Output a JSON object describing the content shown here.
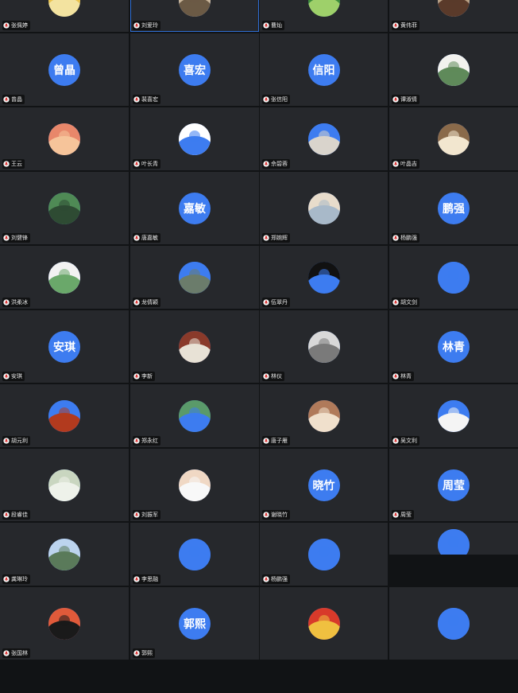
{
  "meeting": {
    "participants": [
      {
        "name": "张佩婷",
        "avatar_type": "photo",
        "avatar_colors": [
          "#e9c24d",
          "#f3e3a0"
        ],
        "speaking": false
      },
      {
        "name": "刘爱玲",
        "avatar_type": "photo",
        "avatar_colors": [
          "#c8b59a",
          "#6b5a45"
        ],
        "speaking": true
      },
      {
        "name": "曹灿",
        "avatar_type": "photo",
        "avatar_colors": [
          "#3c8a3a",
          "#9ed06a"
        ],
        "speaking": false
      },
      {
        "name": "黄伟菲",
        "avatar_type": "photo",
        "avatar_colors": [
          "#b8a084",
          "#5a3a2a"
        ],
        "speaking": false
      },
      {
        "name": "曾晶",
        "avatar_type": "text",
        "avatar_text": "曾晶"
      },
      {
        "name": "裴喜宏",
        "avatar_type": "text",
        "avatar_text": "喜宏"
      },
      {
        "name": "张信阳",
        "avatar_type": "text",
        "avatar_text": "信阳"
      },
      {
        "name": "谭淑倩",
        "avatar_type": "photo",
        "avatar_colors": [
          "#f2f2ee",
          "#5f8a5a"
        ]
      },
      {
        "name": "王云",
        "avatar_type": "photo",
        "avatar_colors": [
          "#e8876a",
          "#f6c49a"
        ]
      },
      {
        "name": "叶长青",
        "avatar_type": "photo",
        "avatar_colors": [
          "#ffffff",
          "#3d7cf0"
        ]
      },
      {
        "name": "佘碧蓉",
        "avatar_type": "photo",
        "avatar_colors": [
          "#3d7cf0",
          "#d9d4cc"
        ]
      },
      {
        "name": "叶晶吉",
        "avatar_type": "photo",
        "avatar_colors": [
          "#8a6a4a",
          "#f2e6cf"
        ]
      },
      {
        "name": "刘健锋",
        "avatar_type": "photo",
        "avatar_colors": [
          "#4f8a55",
          "#2e4b33"
        ]
      },
      {
        "name": "唐嘉敏",
        "avatar_type": "text",
        "avatar_text": "嘉敏"
      },
      {
        "name": "郑婉辉",
        "avatar_type": "photo",
        "avatar_colors": [
          "#e8dccb",
          "#a8b9c9"
        ]
      },
      {
        "name": "杨鹏强",
        "avatar_type": "text",
        "avatar_text": "鹏强"
      },
      {
        "name": "洪柔冰",
        "avatar_type": "photo",
        "avatar_colors": [
          "#f2f2f2",
          "#6aa86a"
        ]
      },
      {
        "name": "龙倩颖",
        "avatar_type": "photo",
        "avatar_colors": [
          "#3d7cf0",
          "#6b7c6b"
        ]
      },
      {
        "name": "伍翠丹",
        "avatar_type": "photo",
        "avatar_colors": [
          "#111111",
          "#3d7cf0"
        ]
      },
      {
        "name": "胡文剑",
        "avatar_type": "photo",
        "avatar_colors": [
          "#3d7cf0",
          "#3d7cf0"
        ]
      },
      {
        "name": "安琪",
        "avatar_type": "text",
        "avatar_text": "安琪"
      },
      {
        "name": "李新",
        "avatar_type": "photo",
        "avatar_colors": [
          "#8a3a2a",
          "#e8e2d6"
        ]
      },
      {
        "name": "林仪",
        "avatar_type": "photo",
        "avatar_colors": [
          "#d8d8d8",
          "#7a7a7a"
        ]
      },
      {
        "name": "林青",
        "avatar_type": "text",
        "avatar_text": "林青"
      },
      {
        "name": "胡元利",
        "avatar_type": "photo",
        "avatar_colors": [
          "#3d7cf0",
          "#b23a1e"
        ]
      },
      {
        "name": "郑永红",
        "avatar_type": "photo",
        "avatar_colors": [
          "#5a9a6a",
          "#3d7cf0"
        ]
      },
      {
        "name": "唐子雁",
        "avatar_type": "photo",
        "avatar_colors": [
          "#b07a5a",
          "#f0e0cc"
        ]
      },
      {
        "name": "吴文利",
        "avatar_type": "photo",
        "avatar_colors": [
          "#3d7cf0",
          "#f4f4f4"
        ]
      },
      {
        "name": "段睿佳",
        "avatar_type": "photo",
        "avatar_colors": [
          "#c9d6c0",
          "#eef2ea"
        ]
      },
      {
        "name": "刘振军",
        "avatar_type": "photo",
        "avatar_colors": [
          "#f0d8c4",
          "#f8f8f8"
        ]
      },
      {
        "name": "谢晓竹",
        "avatar_type": "text",
        "avatar_text": "晓竹"
      },
      {
        "name": "周莹",
        "avatar_type": "text",
        "avatar_text": "周莹"
      },
      {
        "name": "龚琳玲",
        "avatar_type": "photo",
        "avatar_colors": [
          "#bcd4ee",
          "#5a7a5a"
        ]
      },
      {
        "name": "李思融",
        "avatar_type": "photo",
        "avatar_colors": [
          "#3d7cf0",
          "#3d7cf0"
        ]
      },
      {
        "name": "杨鹏强",
        "avatar_type": "photo",
        "avatar_colors": [
          "#3d7cf0",
          "#3d7cf0"
        ]
      },
      {
        "name": "",
        "avatar_type": "photo",
        "avatar_colors": [
          "#3d7cf0",
          "#3d7cf0"
        ]
      },
      {
        "name": "张国林",
        "avatar_type": "photo",
        "avatar_colors": [
          "#e05a3a",
          "#1a1a1a"
        ]
      },
      {
        "name": "郭熙",
        "avatar_type": "text",
        "avatar_text": "郭熙"
      },
      {
        "name": "",
        "avatar_type": "photo",
        "avatar_colors": [
          "#d83a2a",
          "#f0c040"
        ]
      },
      {
        "name": "",
        "avatar_type": "photo",
        "avatar_colors": [
          "#3d7cf0",
          "#3d7cf0"
        ]
      }
    ]
  },
  "colors": {
    "background": "#111315",
    "tile": "#26282c",
    "accent": "#3d7cf0",
    "active_outline": "#2f6fd6"
  }
}
